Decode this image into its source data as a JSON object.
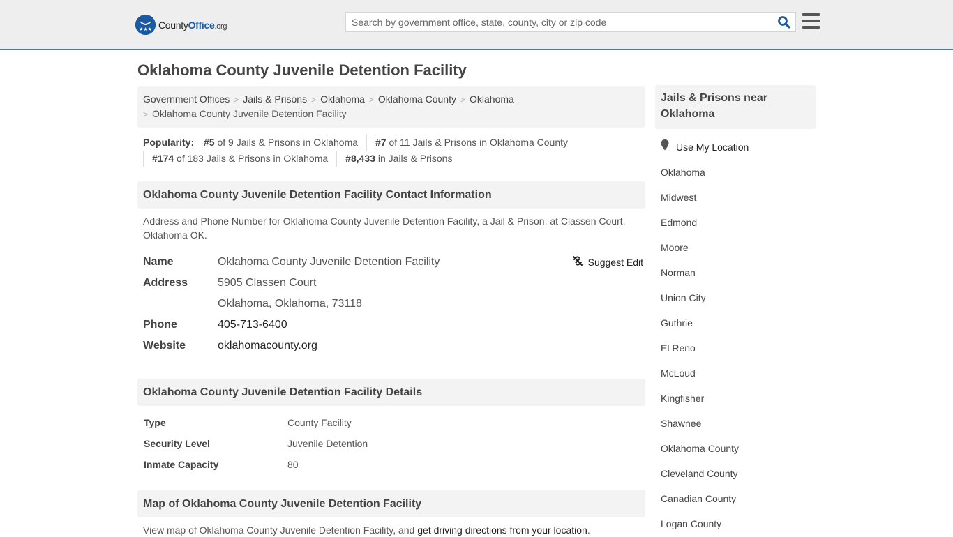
{
  "header": {
    "logo_main": "County",
    "logo_accent": "Office",
    "logo_tld": ".org",
    "search_placeholder": "Search by government office, state, county, city or zip code",
    "search_icon": "magnifier-icon",
    "menu_icon": "hamburger-icon"
  },
  "page_title": "Oklahoma County Juvenile Detention Facility",
  "breadcrumb": [
    "Government Offices",
    "Jails & Prisons",
    "Oklahoma",
    "Oklahoma County",
    "Oklahoma",
    "Oklahoma County Juvenile Detention Facility"
  ],
  "popularity": {
    "label": "Popularity:",
    "items": [
      {
        "rank": "#5",
        "text": " of 9 Jails & Prisons in Oklahoma"
      },
      {
        "rank": "#7",
        "text": " of 11 Jails & Prisons in Oklahoma County"
      },
      {
        "rank": "#174",
        "text": " of 183 Jails & Prisons in Oklahoma"
      },
      {
        "rank": "#8,433",
        "text": " in Jails & Prisons"
      }
    ]
  },
  "contact": {
    "heading": "Oklahoma County Juvenile Detention Facility Contact Information",
    "description": "Address and Phone Number for Oklahoma County Juvenile Detention Facility, a Jail & Prison, at Classen Court, Oklahoma OK.",
    "suggest_edit": "Suggest Edit",
    "rows": {
      "name_label": "Name",
      "name_value": "Oklahoma County Juvenile Detention Facility",
      "address_label": "Address",
      "address_line1": "5905 Classen Court",
      "address_line2": "Oklahoma, Oklahoma, 73118",
      "phone_label": "Phone",
      "phone_value": "405-713-6400",
      "website_label": "Website",
      "website_value": "oklahomacounty.org"
    }
  },
  "details": {
    "heading": "Oklahoma County Juvenile Detention Facility Details",
    "rows": [
      {
        "label": "Type",
        "value": "County Facility"
      },
      {
        "label": "Security Level",
        "value": "Juvenile Detention"
      },
      {
        "label": "Inmate Capacity",
        "value": "80"
      }
    ]
  },
  "map": {
    "heading": "Map of Oklahoma County Juvenile Detention Facility",
    "text_before": "View map of Oklahoma County Juvenile Detention Facility, and ",
    "link": "get driving directions from your location",
    "text_after": "."
  },
  "sidebar": {
    "heading": "Jails & Prisons near Oklahoma",
    "use_location": "Use My Location",
    "links": [
      "Oklahoma",
      "Midwest",
      "Edmond",
      "Moore",
      "Norman",
      "Union City",
      "Guthrie",
      "El Reno",
      "McLoud",
      "Kingfisher",
      "Shawnee",
      "Oklahoma County",
      "Cleveland County",
      "Canadian County",
      "Logan County"
    ]
  },
  "colors": {
    "brand_blue": "#1a5aa3",
    "header_border": "#3a7fb4",
    "panel_bg": "#f3f3f3"
  }
}
